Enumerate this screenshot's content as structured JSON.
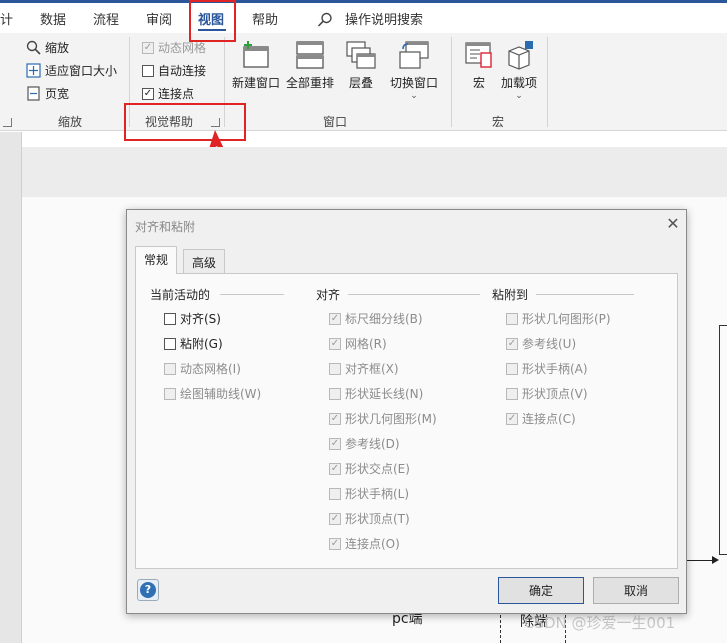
{
  "ribbon": {
    "tabs": [
      {
        "label": "计"
      },
      {
        "label": "数据"
      },
      {
        "label": "流程"
      },
      {
        "label": "审阅"
      },
      {
        "label": "视图"
      },
      {
        "label": "帮助"
      }
    ],
    "search_label": "操作说明搜索",
    "zoom_group": {
      "label": "缩放",
      "items": [
        {
          "label": "缩放",
          "icon": "magnifier-icon"
        },
        {
          "label": "适应窗口大小",
          "icon": "fit-window-icon"
        },
        {
          "label": "页宽",
          "icon": "page-width-icon"
        }
      ]
    },
    "visual_aids_group": {
      "label": "视觉帮助",
      "items": [
        {
          "label": "动态网格",
          "checked": true,
          "disabled": true
        },
        {
          "label": "自动连接",
          "checked": false,
          "disabled": false
        },
        {
          "label": "连接点",
          "checked": true,
          "disabled": false
        }
      ]
    },
    "window_group": {
      "label": "窗口",
      "buttons": [
        {
          "label": "新建窗口",
          "icon": "new-window-icon"
        },
        {
          "label": "全部重排",
          "icon": "arrange-all-icon"
        },
        {
          "label": "层叠",
          "icon": "cascade-icon"
        },
        {
          "label": "切换窗口",
          "icon": "switch-window-icon",
          "has_dropdown": true
        }
      ]
    },
    "macro_group": {
      "label": "宏",
      "buttons": [
        {
          "label": "宏",
          "icon": "macro-icon"
        },
        {
          "label": "加载项",
          "icon": "add-ins-icon",
          "has_dropdown": true
        }
      ]
    }
  },
  "background": {
    "text_pc": "pc端",
    "text_partial": "除端",
    "watermark": "CSDN @珍爱一生001"
  },
  "dialog": {
    "title": "对齐和粘附",
    "tabs": [
      {
        "label": "常规",
        "active": true
      },
      {
        "label": "高级",
        "active": false
      }
    ],
    "columns": [
      {
        "heading": "当前活动的",
        "options": [
          {
            "label": "对齐(S)",
            "checked": false,
            "disabled": false
          },
          {
            "label": "粘附(G)",
            "checked": false,
            "disabled": false
          },
          {
            "label": "动态网格(I)",
            "checked": false,
            "disabled": true
          },
          {
            "label": "绘图辅助线(W)",
            "checked": false,
            "disabled": true
          }
        ]
      },
      {
        "heading": "对齐",
        "options": [
          {
            "label": "标尺细分线(B)",
            "checked": true,
            "disabled": true
          },
          {
            "label": "网格(R)",
            "checked": true,
            "disabled": true
          },
          {
            "label": "对齐框(X)",
            "checked": false,
            "disabled": true
          },
          {
            "label": "形状延长线(N)",
            "checked": false,
            "disabled": true
          },
          {
            "label": "形状几何图形(M)",
            "checked": true,
            "disabled": true
          },
          {
            "label": "参考线(D)",
            "checked": true,
            "disabled": true
          },
          {
            "label": "形状交点(E)",
            "checked": true,
            "disabled": true
          },
          {
            "label": "形状手柄(L)",
            "checked": false,
            "disabled": true
          },
          {
            "label": "形状顶点(T)",
            "checked": true,
            "disabled": true
          },
          {
            "label": "连接点(O)",
            "checked": true,
            "disabled": true
          }
        ]
      },
      {
        "heading": "粘附到",
        "options": [
          {
            "label": "形状几何图形(P)",
            "checked": false,
            "disabled": true
          },
          {
            "label": "参考线(U)",
            "checked": true,
            "disabled": true
          },
          {
            "label": "形状手柄(A)",
            "checked": false,
            "disabled": true
          },
          {
            "label": "形状顶点(V)",
            "checked": false,
            "disabled": true
          },
          {
            "label": "连接点(C)",
            "checked": true,
            "disabled": true
          }
        ]
      }
    ],
    "ok_label": "确定",
    "cancel_label": "取消"
  },
  "colors": {
    "accent": "#2b579a",
    "highlight": "#e02424"
  }
}
